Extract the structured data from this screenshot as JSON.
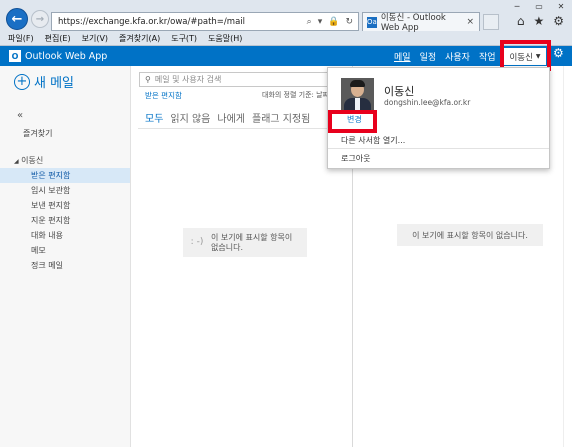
{
  "browser": {
    "url": "https://exchange.kfa.or.kr/owa/#path=/mail",
    "tab_title": "이동신 - Outlook Web App",
    "tab_icon": "Oa",
    "menu": [
      "파일(F)",
      "편집(E)",
      "보기(V)",
      "즐겨찾기(A)",
      "도구(T)",
      "도움말(H)"
    ]
  },
  "app": {
    "title": "Outlook Web App",
    "nav": [
      "메일",
      "일정",
      "사용자",
      "작업"
    ],
    "user_button": "이동신",
    "accent_color": "#0072c6",
    "highlight_color": "#e8001c"
  },
  "sidebar": {
    "new_mail": "새 메일",
    "collapse": "«",
    "favorites": "즐겨찾기",
    "account": "이동신",
    "folders": [
      "받은 편지함",
      "임시 보관함",
      "보낸 편지함",
      "지운 편지함",
      "대화 내용",
      "메모",
      "정크 메일"
    ],
    "selected_folder": "받은 편지함"
  },
  "list": {
    "search_placeholder": "메일 및 사용자 검색",
    "folder_label": "받은 편지함",
    "sort_label": "대화의 정렬 기준: 날짜",
    "filters": [
      "모두",
      "읽지 않음",
      "나에게",
      "플래그 지정됨"
    ],
    "empty_face": ": -)",
    "empty_message_line1": "이 보기에 표시할 항목이",
    "empty_message_line2": "없습니다."
  },
  "reading": {
    "empty_message": "이 보기에 표시할 항목이 없습니다."
  },
  "dropdown": {
    "name": "이동신",
    "email": "dongshin.lee@kfa.or.kr",
    "change_label": "변경",
    "other_mailbox": "다른 사서함 열기...",
    "logout": "로그아웃"
  }
}
